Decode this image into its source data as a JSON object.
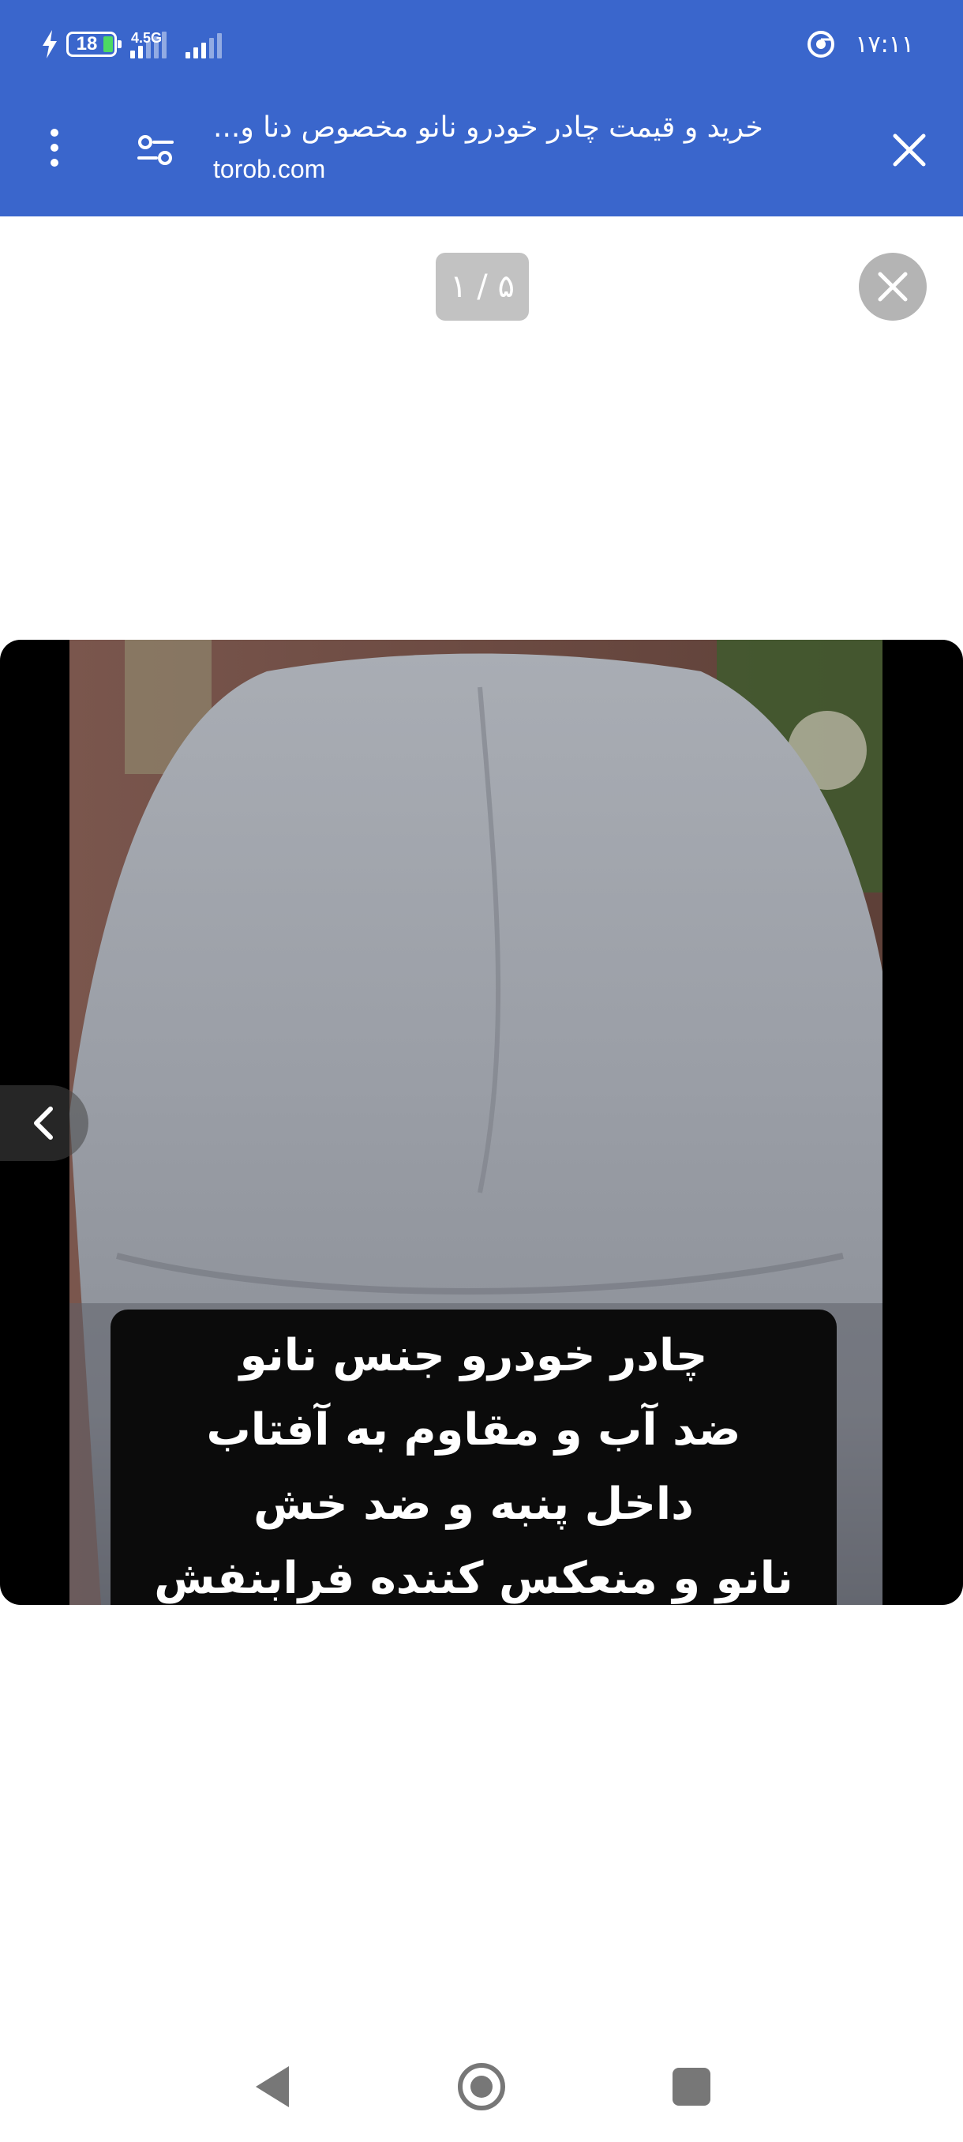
{
  "status_bar": {
    "battery_level": "18",
    "network_type": "4.5G",
    "time": "۱۷:۱۱",
    "icons": [
      "charging-bolt-icon",
      "battery-icon",
      "signal-icon",
      "chrome-icon"
    ]
  },
  "app_bar": {
    "title": "خرید و قیمت چادر خودرو نانو مخصوص دنا و...",
    "url": "torob.com",
    "icons": [
      "more-vert-icon",
      "page-settings-icon",
      "close-icon"
    ]
  },
  "gallery": {
    "counter": "۱ / ۵",
    "caption_lines": [
      "چادر خودرو جنس نانو",
      "ضد آب و مقاوم به آفتاب",
      "داخل پنبه و ضد خش",
      "نانو و منعکس کننده فرابنفش"
    ],
    "icons": [
      "close-circle-icon",
      "chevron-left-icon"
    ]
  },
  "nav_bar": {
    "icons": [
      "back-triangle-icon",
      "home-circle-icon",
      "recents-square-icon"
    ]
  },
  "colors": {
    "brand_bar": "#3a66cc",
    "battery_green": "#4cd964",
    "counter_bg": "#c2c2c2"
  }
}
